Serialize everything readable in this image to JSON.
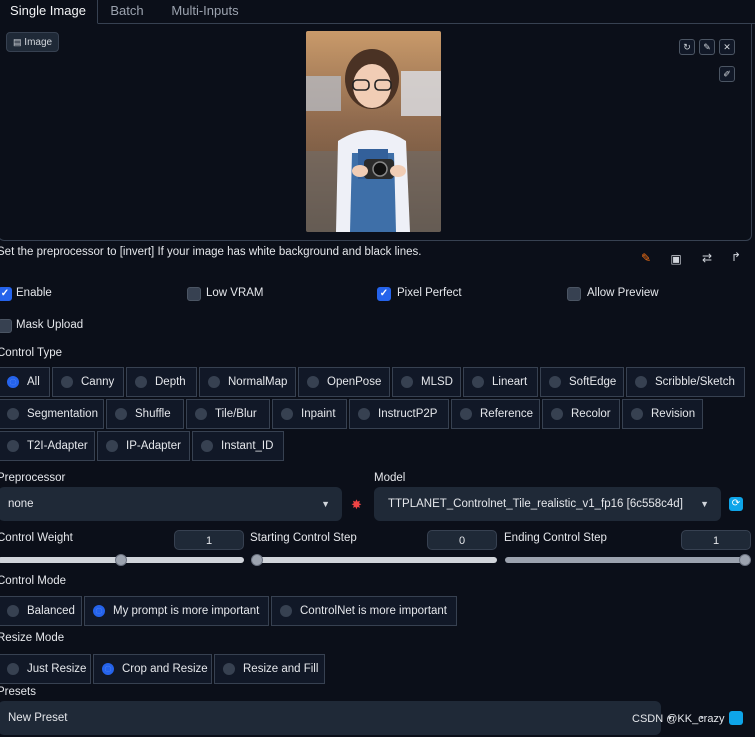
{
  "tabs": [
    "Single Image",
    "Batch",
    "Multi-Inputs"
  ],
  "image_label": "Image",
  "image_tools": {
    "rotate_icon": "↻",
    "edit_icon": "✎",
    "close_icon": "✕",
    "pencil_icon": "✐"
  },
  "hint": "Set the preprocessor to [invert] If your image has white background and black lines.",
  "checkboxes": {
    "enable": {
      "label": "Enable",
      "checked": true
    },
    "low_vram": {
      "label": "Low VRAM",
      "checked": false
    },
    "pixel_perfect": {
      "label": "Pixel Perfect",
      "checked": true
    },
    "allow_preview": {
      "label": "Allow Preview",
      "checked": false
    },
    "mask_upload": {
      "label": "Mask Upload",
      "checked": false
    }
  },
  "control_type": {
    "label": "Control Type",
    "selected": "All",
    "options": [
      "All",
      "Canny",
      "Depth",
      "NormalMap",
      "OpenPose",
      "MLSD",
      "Lineart",
      "SoftEdge",
      "Scribble/Sketch",
      "Segmentation",
      "Shuffle",
      "Tile/Blur",
      "Inpaint",
      "InstructP2P",
      "Reference",
      "Recolor",
      "Revision",
      "T2I-Adapter",
      "IP-Adapter",
      "Instant_ID"
    ]
  },
  "preprocessor": {
    "label": "Preprocessor",
    "value": "none"
  },
  "model": {
    "label": "Model",
    "value": "TTPLANET_Controlnet_Tile_realistic_v1_fp16 [6c558c4d]"
  },
  "sliders": {
    "control_weight": {
      "label": "Control Weight",
      "value": "1",
      "fraction": 0.5
    },
    "starting_step": {
      "label": "Starting Control Step",
      "value": "0",
      "fraction": 0.0
    },
    "ending_step": {
      "label": "Ending Control Step",
      "value": "1",
      "fraction": 1.0
    }
  },
  "control_mode": {
    "label": "Control Mode",
    "options": [
      "Balanced",
      "My prompt is more important",
      "ControlNet is more important"
    ],
    "selected": "My prompt is more important"
  },
  "resize_mode": {
    "label": "Resize Mode",
    "options": [
      "Just Resize",
      "Crop and Resize",
      "Resize and Fill"
    ],
    "selected": "Crop and Resize"
  },
  "presets": {
    "label": "Presets",
    "value": "New Preset"
  },
  "watermark": "CSDN @KK_crazy",
  "colors": {
    "accent": "#2563eb",
    "background": "#0b0f19",
    "panel": "#1f2937",
    "border": "#374151"
  }
}
